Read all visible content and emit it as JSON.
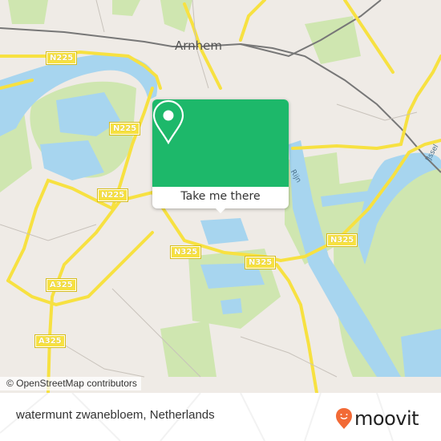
{
  "map": {
    "city_label": "Arnhem",
    "road_labels": [
      "N225",
      "N225",
      "N225",
      "N225",
      "N325",
      "N325",
      "N325",
      "A325",
      "A325"
    ],
    "water_labels": [
      "Rijn",
      "IJssel"
    ],
    "colors": {
      "land": "#efebe6",
      "water": "#a7d5ef",
      "park": "#cfe6b0",
      "road": "#f7e141",
      "rail": "#777777"
    }
  },
  "popup": {
    "pin_icon": "map-pin-icon",
    "button_label": "Take me there",
    "accent_color": "#1db86a"
  },
  "attribution": "© OpenStreetMap contributors",
  "footer": {
    "location_title": "watermunt zwanebloem, Netherlands",
    "brand": "moovit",
    "brand_color": "#f26a36"
  }
}
